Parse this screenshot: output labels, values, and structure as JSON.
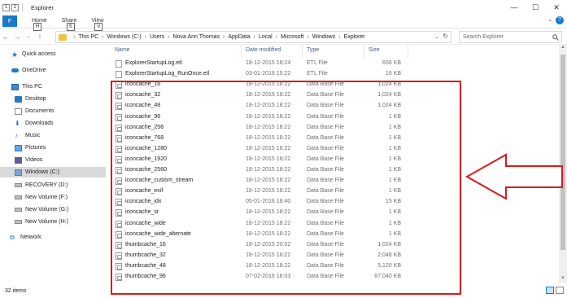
{
  "window": {
    "title": "Explorer",
    "quick_access": [
      "1",
      "2"
    ],
    "controls": {
      "minimize": "—",
      "maximize": "☐",
      "close": "✕"
    }
  },
  "ribbon": {
    "file": {
      "label": "F",
      "keytip": ""
    },
    "tabs": [
      {
        "label": "Home",
        "keytip": "H"
      },
      {
        "label": "Share",
        "keytip": "S"
      },
      {
        "label": "View",
        "keytip": "V"
      }
    ],
    "expand": "⌄",
    "help": "?"
  },
  "address": {
    "crumbs": [
      "This PC",
      "Windows (C:)",
      "Users",
      "Nova Ann Thomas",
      "AppData",
      "Local",
      "Microsoft",
      "Windows",
      "Explorer"
    ],
    "search_placeholder": "Search Explorer"
  },
  "nav": [
    {
      "label": "Quick access",
      "icon": "star-icon"
    },
    {
      "label": "OneDrive",
      "icon": "cloud-icon"
    },
    {
      "label": "This PC",
      "icon": "computer-icon"
    },
    {
      "label": "Desktop",
      "icon": "desktop-icon"
    },
    {
      "label": "Documents",
      "icon": "documents-icon"
    },
    {
      "label": "Downloads",
      "icon": "download-icon"
    },
    {
      "label": "Music",
      "icon": "music-icon"
    },
    {
      "label": "Pictures",
      "icon": "pictures-icon"
    },
    {
      "label": "Videos",
      "icon": "videos-icon"
    },
    {
      "label": "Windows (C:)",
      "icon": "windows-drive-icon",
      "selected": true
    },
    {
      "label": "RECOVERY (D:)",
      "icon": "drive-icon"
    },
    {
      "label": "New Volume (F:)",
      "icon": "drive-icon"
    },
    {
      "label": "New Volume (G:)",
      "icon": "drive-icon"
    },
    {
      "label": "New Volume (H:)",
      "icon": "drive-icon"
    },
    {
      "label": "Network",
      "icon": "network-icon"
    }
  ],
  "columns": {
    "name": "Name",
    "date": "Date modified",
    "type": "Type",
    "size": "Size"
  },
  "files": [
    {
      "name": "ExplorerStartupLog.etl",
      "date": "18-12-2015 18:24",
      "type": "ETL File",
      "size": "656 KB"
    },
    {
      "name": "ExplorerStartupLog_RunOnce.etl",
      "date": "03-01-2016 15:22",
      "type": "ETL File",
      "size": "16 KB"
    },
    {
      "name": "iconcache_16",
      "date": "18-12-2015 18:22",
      "type": "Data Base File",
      "size": "1,024 KB"
    },
    {
      "name": "iconcache_32",
      "date": "18-12-2015 18:22",
      "type": "Data Base File",
      "size": "1,024 KB"
    },
    {
      "name": "iconcache_48",
      "date": "18-12-2015 18:22",
      "type": "Data Base File",
      "size": "1,024 KB"
    },
    {
      "name": "iconcache_96",
      "date": "18-12-2015 18:22",
      "type": "Data Base File",
      "size": "1 KB"
    },
    {
      "name": "iconcache_256",
      "date": "18-12-2015 18:22",
      "type": "Data Base File",
      "size": "1 KB"
    },
    {
      "name": "iconcache_768",
      "date": "18-12-2015 18:22",
      "type": "Data Base File",
      "size": "1 KB"
    },
    {
      "name": "iconcache_1280",
      "date": "18-12-2015 18:22",
      "type": "Data Base File",
      "size": "1 KB"
    },
    {
      "name": "iconcache_1920",
      "date": "18-12-2015 18:22",
      "type": "Data Base File",
      "size": "1 KB"
    },
    {
      "name": "iconcache_2560",
      "date": "18-12-2015 18:22",
      "type": "Data Base File",
      "size": "1 KB"
    },
    {
      "name": "iconcache_custom_stream",
      "date": "18-12-2015 18:22",
      "type": "Data Base File",
      "size": "1 KB"
    },
    {
      "name": "iconcache_exif",
      "date": "18-12-2015 18:22",
      "type": "Data Base File",
      "size": "1 KB"
    },
    {
      "name": "iconcache_idx",
      "date": "05-01-2016 18:40",
      "type": "Data Base File",
      "size": "15 KB"
    },
    {
      "name": "iconcache_sr",
      "date": "18-12-2015 18:22",
      "type": "Data Base File",
      "size": "1 KB"
    },
    {
      "name": "iconcache_wide",
      "date": "18-12-2015 18:22",
      "type": "Data Base File",
      "size": "1 KB"
    },
    {
      "name": "iconcache_wide_alternate",
      "date": "18-12-2015 18:22",
      "type": "Data Base File",
      "size": "1 KB"
    },
    {
      "name": "thumbcache_16",
      "date": "18-12-2015 20:02",
      "type": "Data Base File",
      "size": "1,024 KB"
    },
    {
      "name": "thumbcache_32",
      "date": "18-12-2015 18:22",
      "type": "Data Base File",
      "size": "2,048 KB"
    },
    {
      "name": "thumbcache_48",
      "date": "18-12-2015 18:22",
      "type": "Data Base File",
      "size": "5,120 KB"
    },
    {
      "name": "thumbcache_96",
      "date": "07-02-2016 18:03",
      "type": "Data Base File",
      "size": "87,040 KB"
    }
  ],
  "status": {
    "count": "32 items"
  },
  "colors": {
    "accent": "#1979ca",
    "annotation": "#d81b1b",
    "selected_bg": "#d9d9d9"
  }
}
